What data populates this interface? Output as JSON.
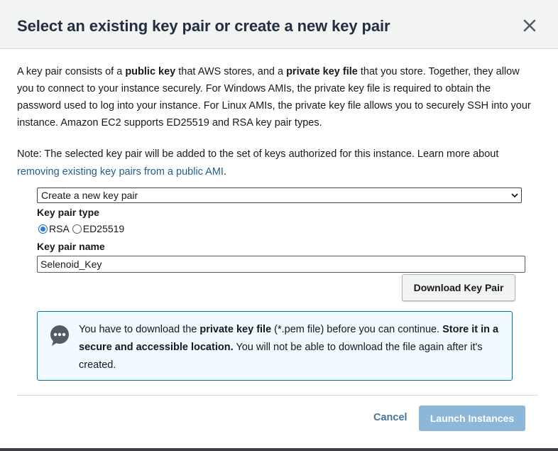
{
  "dialog": {
    "title": "Select an existing key pair or create a new key pair",
    "description": {
      "p1": "A key pair consists of a ",
      "b1": "public key",
      "p2": " that AWS stores, and a ",
      "b2": "private key file",
      "p3": " that you store. Together, they allow you to connect to your instance securely. For Windows AMIs, the private key file is required to obtain the password used to log into your instance. For Linux AMIs, the private key file allows you to securely SSH into your instance. Amazon EC2 supports ED25519 and RSA key pair types."
    },
    "note": {
      "text": "Note: The selected key pair will be added to the set of keys authorized for this instance. Learn more about ",
      "link": "removing existing key pairs from a public AMI",
      "end": "."
    },
    "key_pair_select": {
      "value": "Create a new key pair"
    },
    "key_pair_type": {
      "label": "Key pair type",
      "options": [
        {
          "label": "RSA",
          "selected": true
        },
        {
          "label": "ED25519",
          "selected": false
        }
      ]
    },
    "key_pair_name": {
      "label": "Key pair name",
      "value": "Selenoid_Key"
    },
    "download_button": "Download Key Pair",
    "info": {
      "t1": "You have to download the ",
      "b1": "private key file",
      "t2": " (*.pem file) before you can continue. ",
      "b2": "Store it in a secure and accessible location.",
      "t3": " You will not be able to download the file again after it's created."
    },
    "footer": {
      "cancel": "Cancel",
      "launch": "Launch Instances"
    }
  },
  "colors": {
    "link": "#1f5e8c",
    "info_border": "#0073bb",
    "info_bg": "#f1faff",
    "launch_disabled": "#8db7d8"
  }
}
